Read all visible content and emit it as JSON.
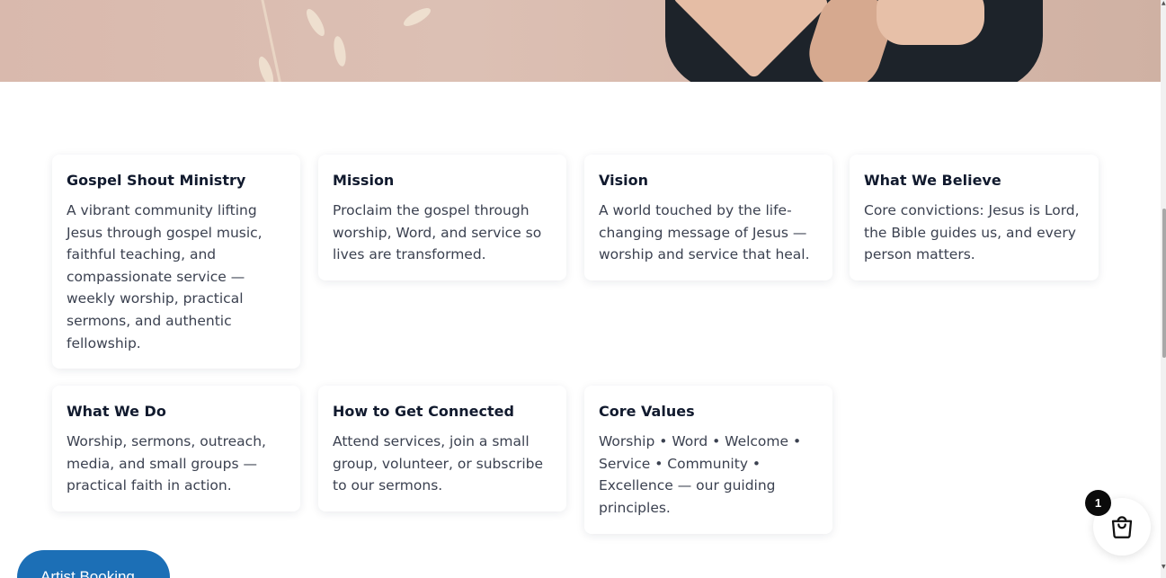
{
  "cards": [
    {
      "title": "Gospel Shout Ministry",
      "body": "A vibrant community lifting Jesus through gospel music, faithful teaching, and compassionate service — weekly worship, practical sermons, and authentic fellowship."
    },
    {
      "title": "Mission",
      "body": "Proclaim the gospel through worship, Word, and service so lives are transformed."
    },
    {
      "title": "Vision",
      "body": "A world touched by the life-changing message of Jesus — worship and service that heal."
    },
    {
      "title": "What We Believe",
      "body": "Core convictions: Jesus is Lord, the Bible guides us, and every person matters."
    },
    {
      "title": "What We Do",
      "body": "Worship, sermons, outreach, media, and small groups — practical faith in action."
    },
    {
      "title": "How to Get Connected",
      "body": "Attend services, join a small group, volunteer, or subscribe to our sermons."
    },
    {
      "title": "Core Values",
      "body": "Worship • Word • Welcome • Service • Community • Excellence — our guiding principles."
    }
  ],
  "floating": {
    "artist_booking_label": "Artist Booking",
    "cart_count": "1"
  },
  "icons": {
    "cart": "shopping-bag-icon"
  },
  "colors": {
    "accent_blue": "#1c6fb6",
    "heading_text": "#111a2e",
    "body_text": "#3b4150"
  }
}
